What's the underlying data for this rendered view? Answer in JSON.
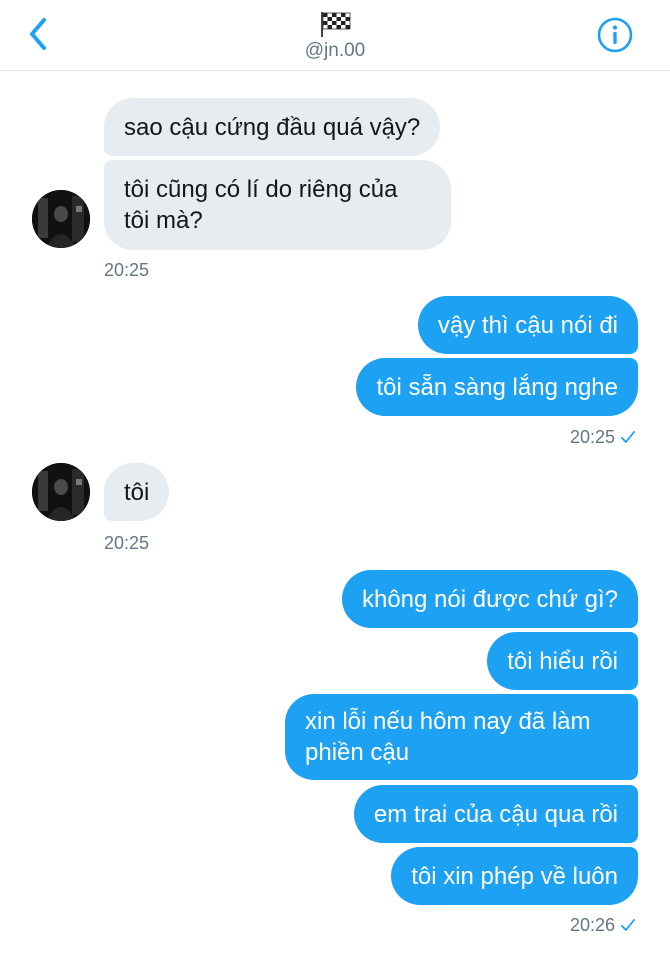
{
  "header": {
    "handle": "@jn.00",
    "back_icon": "chevron-left-icon",
    "info_icon": "info-icon",
    "flag_icon": "checkered-flag-icon",
    "accent_color": "#1da1f2"
  },
  "messages": [
    {
      "sender": "other",
      "text": "sao cậu cứng đầu quá vậy?"
    },
    {
      "sender": "other",
      "lines": [
        "tôi cũng có lí do riêng của",
        "tôi mà?"
      ]
    },
    {
      "sender": "other_time",
      "time": "20:25"
    },
    {
      "sender": "me",
      "text": "vậy thì cậu nói đi"
    },
    {
      "sender": "me",
      "text": "tôi sẵn sàng lắng nghe"
    },
    {
      "sender": "me_time",
      "time": "20:25",
      "status": "sent-check-icon"
    },
    {
      "sender": "other",
      "text": "tôi"
    },
    {
      "sender": "other_time",
      "time": "20:25"
    },
    {
      "sender": "me",
      "text": "không nói được chứ gì?"
    },
    {
      "sender": "me",
      "text": "tôi hiểu rồi"
    },
    {
      "sender": "me",
      "lines": [
        "xin lỗi nếu hôm nay đã làm",
        "phiền cậu"
      ]
    },
    {
      "sender": "me",
      "text": "em trai của cậu qua rồi"
    },
    {
      "sender": "me",
      "text": "tôi xin phép về luôn"
    },
    {
      "sender": "me_time",
      "time": "20:26",
      "status": "sent-check-icon"
    }
  ]
}
